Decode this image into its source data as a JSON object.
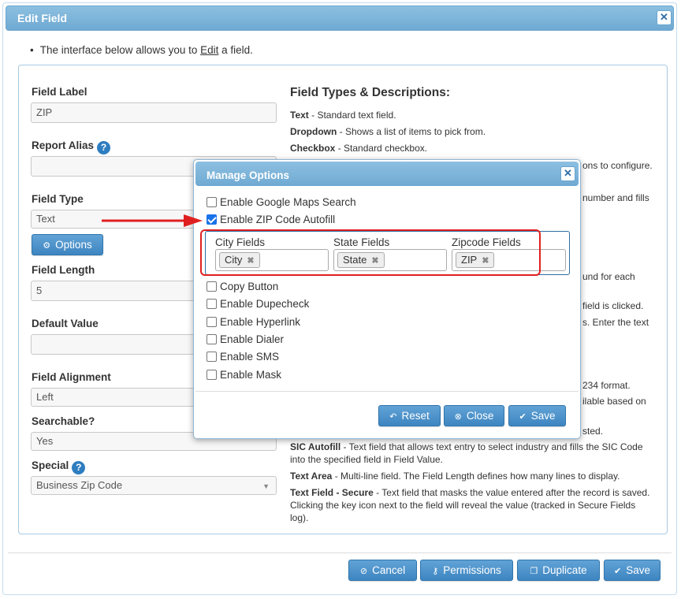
{
  "window": {
    "title": "Edit Field",
    "close_glyph": "✕"
  },
  "intro": {
    "bullet": "•",
    "pre": "The interface below allows you to",
    "link": "Edit",
    "post": "a field."
  },
  "form": {
    "field_label": {
      "label": "Field Label",
      "value": "ZIP"
    },
    "report_alias": {
      "label": "Report Alias",
      "help": "?",
      "value": ""
    },
    "field_type": {
      "label": "Field Type",
      "value": "Text"
    },
    "options_button": "Options",
    "field_length": {
      "label": "Field Length",
      "value": "5"
    },
    "default_value": {
      "label": "Default Value",
      "value": ""
    },
    "field_alignment": {
      "label": "Field Alignment",
      "value": "Left"
    },
    "searchable": {
      "label": "Searchable?",
      "value": "Yes"
    },
    "special": {
      "label": "Special",
      "help": "?",
      "value": "Business Zip Code"
    }
  },
  "descriptions": {
    "title": "Field Types & Descriptions:",
    "items": [
      {
        "name": "Text",
        "text": "Standard text field."
      },
      {
        "name": "Dropdown",
        "text": "Shows a list of items to pick from."
      },
      {
        "name": "Checkbox",
        "text": "Standard checkbox."
      }
    ],
    "fragments": {
      "f1": "ons to configure.",
      "f2": "number and fills",
      "f3": "und for each",
      "f4": "field is clicked.",
      "f5": "s. Enter the text",
      "f6": "234 format.",
      "f7": "ilable based on",
      "f8": "sted."
    },
    "sic": {
      "name": "SIC Autofill",
      "text": "Text field that allows text entry to select industry and fills the SIC Code into the specified field in Field Value."
    },
    "textarea": {
      "name": "Text Area",
      "text": "Multi-line field. The Field Length defines how many lines to display."
    },
    "secure": {
      "name": "Text Field - Secure",
      "text": "Text field that masks the value entered after the record is saved. Clicking the key icon next to the field will reveal the value (tracked in Secure Fields log)."
    }
  },
  "footer": {
    "cancel": "Cancel",
    "permissions": "Permissions",
    "duplicate": "Duplicate",
    "save": "Save"
  },
  "modal": {
    "title": "Manage Options",
    "close_glyph": "✕",
    "options": [
      {
        "label": "Enable Google Maps Search",
        "checked": false
      },
      {
        "label": "Enable ZIP Code Autofill",
        "checked": true
      }
    ],
    "zip": {
      "city": {
        "label": "City Fields",
        "tag": "City"
      },
      "state": {
        "label": "State Fields",
        "tag": "State"
      },
      "zipcode": {
        "label": "Zipcode Fields",
        "tag": "ZIP"
      },
      "remove_glyph": "✖"
    },
    "more_options": [
      {
        "label": "Copy Button",
        "checked": false
      },
      {
        "label": "Enable Dupecheck",
        "checked": false
      },
      {
        "label": "Enable Hyperlink",
        "checked": false
      },
      {
        "label": "Enable Dialer",
        "checked": false
      },
      {
        "label": "Enable SMS",
        "checked": false
      },
      {
        "label": "Enable Mask",
        "checked": false
      }
    ],
    "buttons": {
      "reset": "Reset",
      "close": "Close",
      "save": "Save"
    }
  },
  "colors": {
    "accent": "#3d85c1",
    "annotation": "#e02020"
  }
}
